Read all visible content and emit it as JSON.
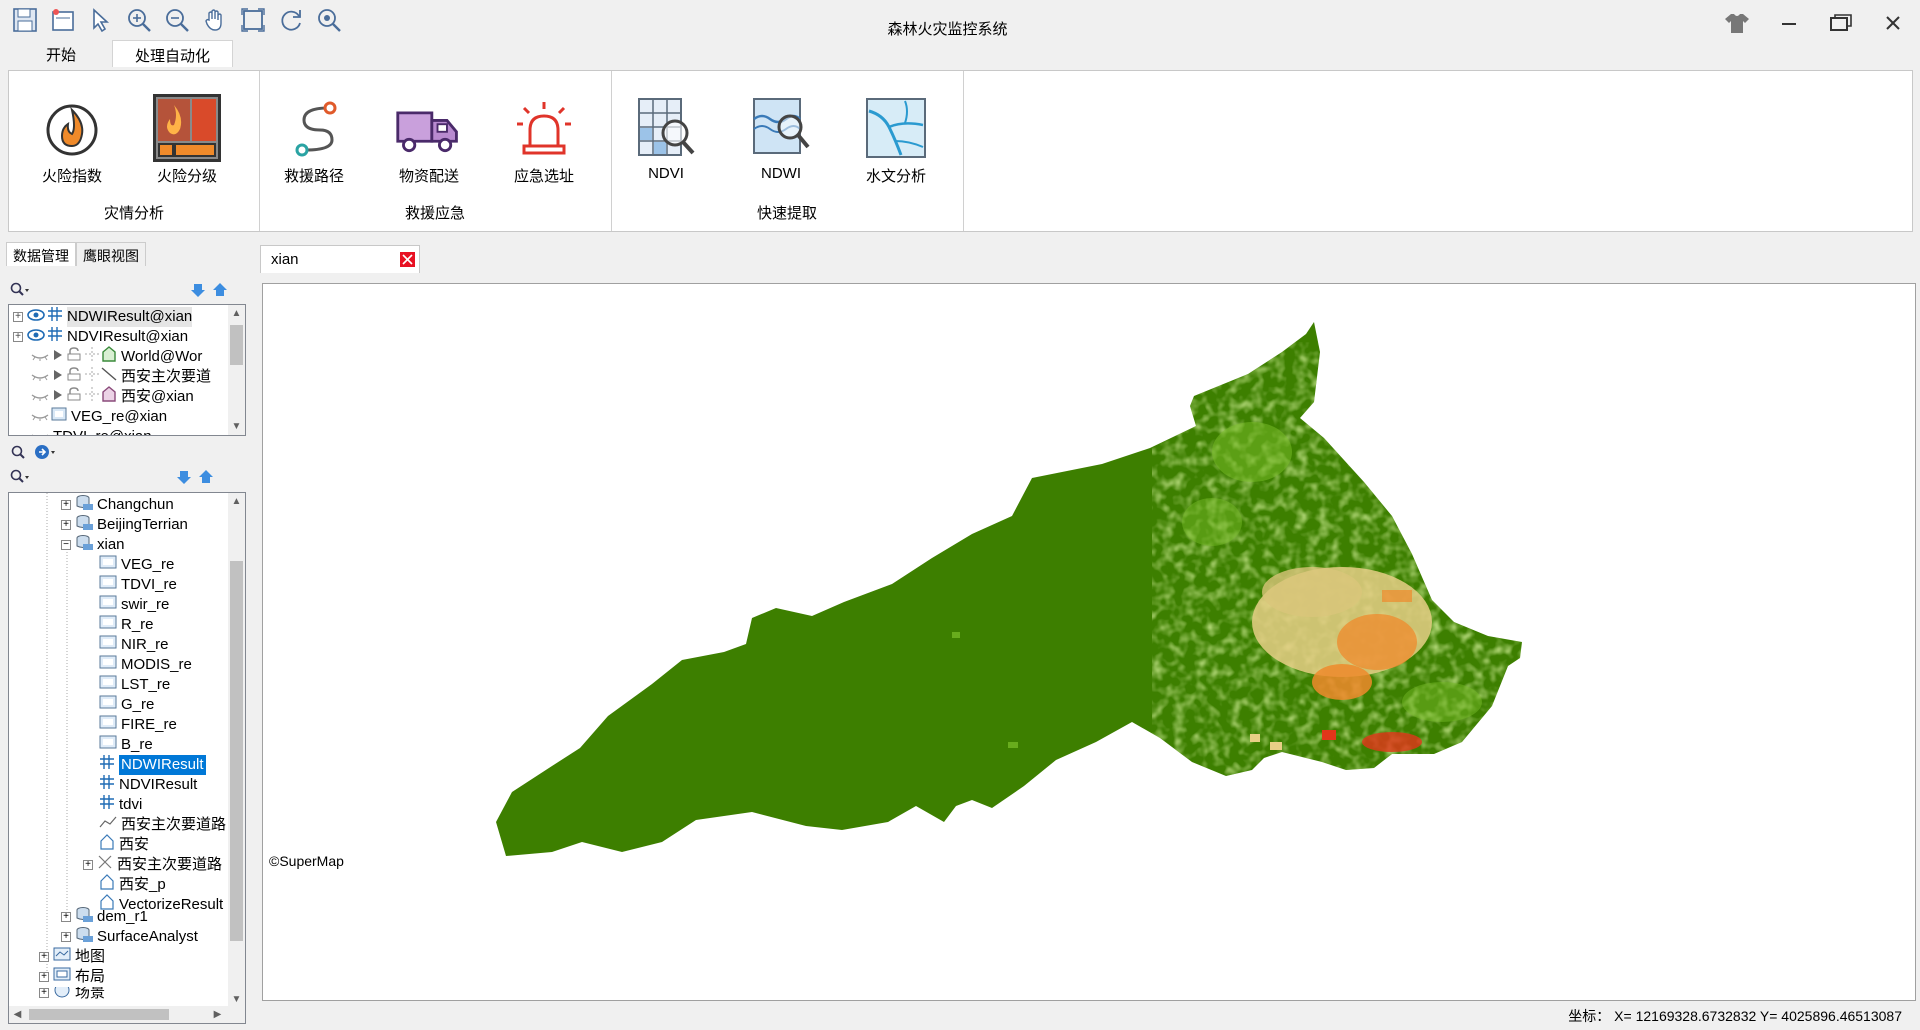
{
  "window": {
    "title": "森林火灾监控系统",
    "quick_access": [
      "save-icon",
      "new-icon",
      "select-icon",
      "zoom-in-icon",
      "zoom-out-icon",
      "pan-icon",
      "full-extent-icon",
      "refresh-icon",
      "zoom-search-icon"
    ]
  },
  "ribbon": {
    "tabs": [
      "开始",
      "处理自动化"
    ],
    "active_tab": "处理自动化",
    "groups": [
      {
        "title": "灾情分析",
        "buttons": [
          "火险指数",
          "火险分级"
        ]
      },
      {
        "title": "救援应急",
        "buttons": [
          "救援路径",
          "物资配送",
          "应急选址"
        ]
      },
      {
        "title": "快速提取",
        "buttons": [
          "NDVI",
          "NDWI",
          "水文分析"
        ]
      }
    ]
  },
  "left_panel": {
    "tabs": [
      "数据管理",
      "鹰眼视图"
    ],
    "layers": [
      "NDWIResult@xian",
      "NDVIResult@xian",
      "World@Wor",
      "西安主次要道",
      "西安@xian",
      "VEG_re@xian",
      "TDVI_re@xian"
    ],
    "workspace_tree": {
      "datasources": [
        "Changchun",
        "BeijingTerrian",
        "xian"
      ],
      "datasets": [
        "VEG_re",
        "TDVI_re",
        "swir_re",
        "R_re",
        "NIR_re",
        "MODIS_re",
        "LST_re",
        "G_re",
        "FIRE_re",
        "B_re",
        "NDWIResult",
        "NDVIResult",
        "tdvi",
        "西安主次要道路",
        "西安",
        "西安主次要道路",
        "西安_p",
        "VectorizeResult"
      ],
      "more_datasources": [
        "dem_r1",
        "SurfaceAnalyst"
      ],
      "folders": [
        "地图",
        "布局",
        "场景"
      ]
    }
  },
  "map": {
    "tab_title": "xian",
    "copyright": "©SuperMap"
  },
  "status": {
    "coords": "坐标： X= 12169328.6732832 Y= 4025896.46513087"
  },
  "colors": {
    "forest": "#3d7f00",
    "light_green": "#7bbf2a",
    "pale": "#e8cf86",
    "orange": "#ef8a2c",
    "red": "#e2361a"
  }
}
